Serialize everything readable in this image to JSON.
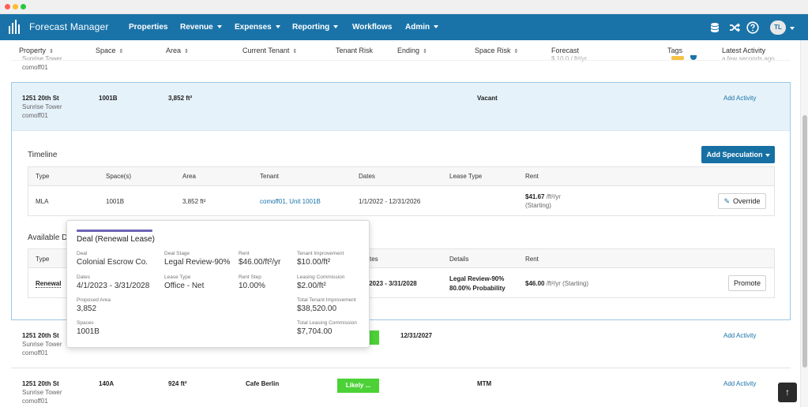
{
  "nav": {
    "brand": "Forecast Manager",
    "items": [
      "Properties",
      "Revenue",
      "Expenses",
      "Reporting",
      "Workflows",
      "Admin"
    ],
    "avatar": "TL"
  },
  "columns": [
    "Property",
    "Space",
    "Area",
    "Current Tenant",
    "Tenant Risk",
    "Ending",
    "Space Risk",
    "Forecast",
    "Tags",
    "Latest Activity"
  ],
  "top_row": {
    "property": "Sunrise Tower",
    "owner": "comoff01",
    "forecast": "$ 10.0 / ft²/yr",
    "activity": "a few seconds ago"
  },
  "selected_row": {
    "address": "1251 20th St",
    "building": "Sunrise Tower",
    "owner": "comoff01",
    "space": "1001B",
    "area": "3,852 ft²",
    "space_risk": "Vacant",
    "action": "Add Activity"
  },
  "timeline": {
    "title": "Timeline",
    "add_button": "Add Speculation",
    "headers": [
      "Type",
      "Space(s)",
      "Area",
      "Tenant",
      "Dates",
      "Lease Type",
      "Rent"
    ],
    "row": {
      "type": "MLA",
      "space": "1001B",
      "area": "3,852 ft²",
      "tenant": "comoff01, Unit 1001B",
      "dates": "1/1/2022 - 12/31/2026",
      "rent": "$41.67",
      "rent_unit": "/ft²/yr",
      "rent_note": "(Starting)",
      "override": "Override"
    }
  },
  "available": {
    "title": "Available D",
    "headers": [
      "Type",
      "tes",
      "Details",
      "Rent"
    ],
    "row": {
      "type": "Renewal",
      "dates": "/2023 - 3/31/2028",
      "detail_1": "Legal Review-90%",
      "detail_2": "80.00% Probability",
      "rent": "$46.00",
      "rent_unit": "/ft²/yr (Starting)",
      "promote": "Promote"
    }
  },
  "popover": {
    "title": "Deal (Renewal Lease)",
    "fields": [
      {
        "label": "Deal",
        "value": "Colonial Escrow Co."
      },
      {
        "label": "Deal Stage",
        "value": "Legal Review-90%"
      },
      {
        "label": "Rent",
        "value": "$46.00/ft²/yr"
      },
      {
        "label": "Tenant Improvement",
        "value": "$10.00/ft²"
      },
      {
        "label": "Dates",
        "value": "4/1/2023 - 3/31/2028"
      },
      {
        "label": "Lease Type",
        "value": "Office - Net"
      },
      {
        "label": "Rent Step",
        "value": "10.00%"
      },
      {
        "label": "Leasing Commission",
        "value": "$2.00/ft²"
      },
      {
        "label": "Proposed Area",
        "value": "3,852"
      },
      {
        "label": "Total Tenant Improvement",
        "value": "$38,520.00"
      },
      {
        "label": "Spaces",
        "value": "1001B"
      },
      {
        "label": "Total Leasing Commission",
        "value": "$7,704.00"
      }
    ]
  },
  "row3": {
    "address": "1251 20th St",
    "building": "Sunrise Tower",
    "owner": "comoff01",
    "ending": "12/31/2027",
    "action": "Add Activity"
  },
  "row4": {
    "address": "1251 20th St",
    "building": "Sunrise Tower",
    "owner": "comoff01",
    "space": "140A",
    "area": "924 ft²",
    "tenant": "Cafe Berlin",
    "risk": "Likely ...",
    "space_risk": "MTM",
    "action": "Add Activity"
  },
  "colors": {
    "navbar": "#1a73a8",
    "primary_button": "#1670a3",
    "status_green": "#4cd137",
    "popover_accent": "#6c63b5"
  }
}
